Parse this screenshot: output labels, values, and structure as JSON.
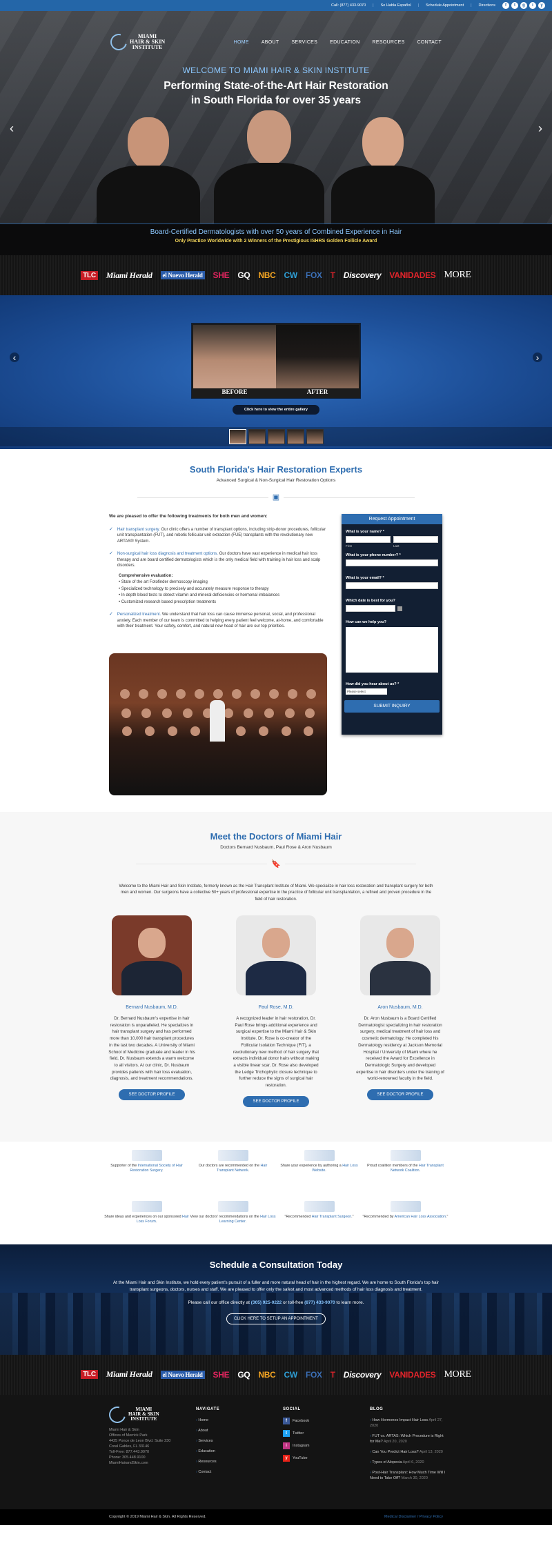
{
  "topbar": {
    "call": "Call: (877) 433-9070",
    "spanish": "Se Habla Español",
    "schedule": "Schedule Appointment",
    "directions": "Directions",
    "social": [
      "f",
      "t",
      "g",
      "i",
      "y"
    ]
  },
  "nav": {
    "logo_line1": "MIAMI",
    "logo_line2": "HAIR & SKIN",
    "logo_line3": "INSTITUTE",
    "items": [
      "HOME",
      "ABOUT",
      "SERVICES",
      "EDUCATION",
      "RESOURCES",
      "CONTACT"
    ]
  },
  "hero": {
    "welcome": "WELCOME TO MIAMI HAIR & SKIN INSTITUTE",
    "title1": "Performing State-of-the-Art Hair Restoration",
    "title2": "in South Florida for over 35 years",
    "band1": "Board-Certified Dermatologists with over 50 years of Combined Experience in Hair",
    "band2": "Only Practice Worldwide with 2 Winners of the Prestigious ISHRS Golden Follicle Award"
  },
  "media": [
    "TLC",
    "Miami Herald",
    "el Nuevo Herald",
    "SHE",
    "GQ",
    "NBC",
    "CW",
    "FOX",
    "T",
    "Discovery",
    "VANIDADES",
    "MORE"
  ],
  "gallery": {
    "before": "BEFORE",
    "after": "AFTER",
    "button": "Click here to view the entire gallery"
  },
  "experts": {
    "title": "South Florida's Hair Restoration Experts",
    "subtitle": "Advanced Surgical & Non-Surgical Hair Restoration Options",
    "intro": "We are pleased to offer the following treatments for both men and women:",
    "items": [
      {
        "head": "Hair transplant surgery.",
        "text": " Our clinic offers a number of transplant options, including strip-donor procedures, follicular unit transplantation (FUT), and robotic follicular unit extraction (FUE) transplants with the revolutionary new ARTAS® System."
      },
      {
        "head": "Non-surgical hair loss diagnosis and treatment options.",
        "text": " Our doctors have vast experience in medical hair loss therapy and are board certified dermatologists which is the only medical field with training in hair loss and scalp disorders."
      },
      {
        "head": "Personalized treatment.",
        "text": " We understand that hair loss can cause immense personal, social, and professional anxiety. Each member of our team is committed to helping every patient feel welcome, at-home, and comfortable with their treatment. Your safety, comfort, and natural new head of hair are our top priorities."
      }
    ],
    "comp_title": "Comprehensive evaluation:",
    "comp": [
      "• State of the art Fotofinder dermoscopy imaging",
      "• Specialized technology to precisely and accurately measure response to therapy",
      "• In depth blood tests to detect vitamin and mineral deficiencies or hormonal imbalances",
      "• Customized research based prescription treatments"
    ]
  },
  "form": {
    "title": "Request Appointment",
    "name": "What is your name? *",
    "first": "First",
    "last": "Last",
    "phone": "What is your phone number? *",
    "email": "What is your email? *",
    "date": "Which date is best for you?",
    "help": "How can we help you?",
    "heard": "How did you hear about us? *",
    "select": "Please select",
    "submit": "SUBMIT INQUIRY"
  },
  "doctors": {
    "title": "Meet the Doctors of Miami Hair",
    "subtitle": "Doctors Bernard Nusbaum, Paul Rose & Aron Nusbaum",
    "desc": "Welcome to the Miami Hair and Skin Institute, formerly known as the Hair Transplant Institute of Miami. We specialize in hair loss restoration and transplant surgery for both men and women. Our surgeons have a collective 50+ years of professional expertise in the practice of follicular unit transplantation, a refined and proven procedure in the field of hair restoration.",
    "cards": [
      {
        "name": "Bernard Nusbaum, M.D.",
        "text": "Dr. Bernard Nusbaum's expertise in hair restoration is unparalleled. He specializes in hair transplant surgery and has performed more than 10,000 hair transplant procedures in the last two decades. A University of Miami School of Medicine graduate and leader in his field, Dr. Nusbaum extends a warm welcome to all visitors. At our clinic, Dr. Nusbaum provides patients with hair loss evaluation, diagnosis, and treatment recommendations.",
        "button": "SEE DOCTOR PROFILE"
      },
      {
        "name": "Paul Rose, M.D.",
        "text": "A recognized leader in hair restoration, Dr. Paul Rose brings additional experience and surgical expertise to the Miami Hair & Skin Institute. Dr. Rose is co-creator of the Follicular Isolation Technique (FIT), a revolutionary new method of hair surgery that extracts individual donor hairs without making a visible linear scar. Dr. Rose also developed the Ledge Trichophytic closure technique to further reduce the signs of surgical hair restoration.",
        "button": "SEE DOCTOR PROFILE"
      },
      {
        "name": "Aron Nusbaum, M.D.",
        "text": "Dr. Aron Nusbaum is a Board Certified Dermatologist specializing in hair restoration surgery, medical treatment of hair loss and cosmetic dermatology. He completed his Dermatology residency at Jackson Memorial Hospital / University of Miami where he received the Award for Excellence in Dermatologic Surgery and developed expertise in hair disorders under the training of world-renowned faculty in the field.",
        "button": "SEE DOCTOR PROFILE"
      }
    ]
  },
  "affiliations": [
    {
      "pre": "Supporter of the ",
      "link": "International Society of Hair Restoration Surgery",
      "post": "."
    },
    {
      "pre": "Our doctors are recommended on the ",
      "link": "Hair Transplant Network",
      "post": "."
    },
    {
      "pre": "Share your experience by authoring a ",
      "link": "Hair Loss Website",
      "post": "."
    },
    {
      "pre": "Proud coalition members of the ",
      "link": "Hair Transplant Network Coalition",
      "post": "."
    },
    {
      "pre": "Share ideas and experiences on our sponsored ",
      "link": "Hair Loss Forum",
      "post": "."
    },
    {
      "pre": "View our doctors' recommendations on the ",
      "link": "Hair Loss Learning Center",
      "post": "."
    },
    {
      "pre": "\"Recommended ",
      "link": "Hair Transplant Surgeon",
      "post": ".\""
    },
    {
      "pre": "\"Recommended by ",
      "link": "American Hair Loss Association",
      "post": ".\""
    }
  ],
  "schedule": {
    "title": "Schedule a Consultation Today",
    "text": "At the Miami Hair and Skin Institute, we hold every patient's pursuit of a fuller and more natural head of hair in the highest regard. We are home to South Florida's top hair transplant surgeons, doctors, nurses and staff. We are pleased to offer only the safest and most advanced methods of hair loss diagnosis and treatment.",
    "phone_pre": "Please call our office directly at ",
    "phone1": "(305) 925-0222",
    "phone_mid": " or toll-free ",
    "phone2": "(877) 433-9070",
    "phone_post": " to learn more.",
    "button": "CLICK HERE TO SETUP AN APPOINTMENT"
  },
  "footer": {
    "addr": [
      "Miami Hair & Skin",
      "Offices of Merrick Park",
      "4425 Ponce de Leon Blvd. Suite 230",
      "Coral Gables, FL 33146",
      "Toll-Free: 877.443.9070",
      "Phone: 305.448.9100",
      "MiamiHairandSkin.com"
    ],
    "nav_title": "NAVIGATE",
    "nav": [
      "Home",
      "About",
      "Services",
      "Education",
      "Resources",
      "Contact"
    ],
    "social_title": "SOCIAL",
    "social": [
      {
        "icon": "f",
        "label": "Facebook"
      },
      {
        "icon": "t",
        "label": "Twitter"
      },
      {
        "icon": "i",
        "label": "Instagram"
      },
      {
        "icon": "y",
        "label": "YouTube"
      }
    ],
    "blog_title": "BLOG",
    "blog": [
      {
        "title": "How Hormones Impact Hair Loss",
        "date": "April 27, 2020"
      },
      {
        "title": "FUT vs. ARTAS: Which Procedure is Right for Me?",
        "date": "April 20, 2020"
      },
      {
        "title": "Can You Predict Hair Loss?",
        "date": "April 13, 2020"
      },
      {
        "title": "Types of Alopecia",
        "date": "April 6, 2020"
      },
      {
        "title": "Post-Hair Transplant: How Much Time Will I Need to Take Off?",
        "date": "March 30, 2020"
      }
    ],
    "copyright": "Copyright © 2019 Miami Hair & Skin. All Rights Reserved.",
    "legal": "Medical Disclaimer / Privacy Policy"
  },
  "colors": {
    "accent": "#2e6db0",
    "topbar": "#2466a8",
    "gold": "#f2d45a"
  }
}
